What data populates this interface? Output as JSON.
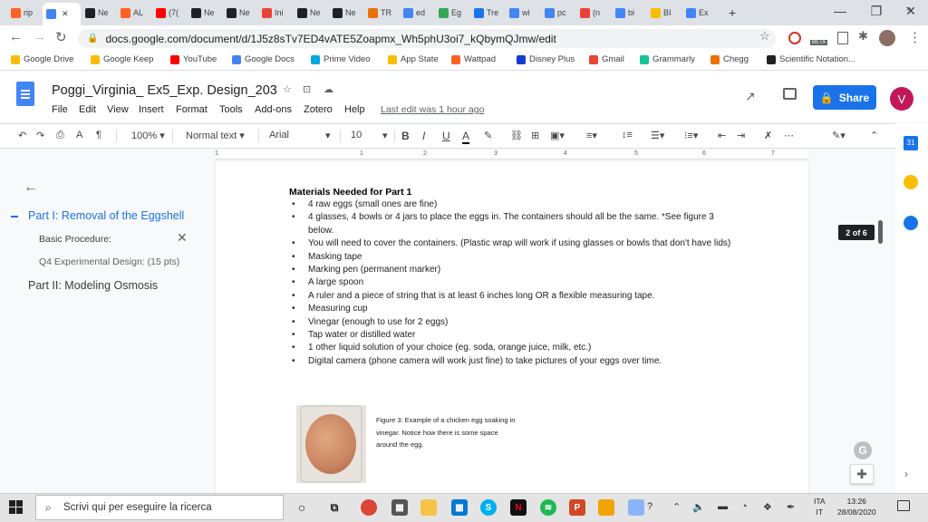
{
  "browser": {
    "tabs": [
      {
        "label": "rip",
        "icon": "wattpad-icon",
        "color": "#ff6122"
      },
      {
        "label": "",
        "icon": "docs-icon",
        "color": "#4285f4",
        "active": true
      },
      {
        "label": "Ne",
        "icon": "circle-icon",
        "color": "#202124"
      },
      {
        "label": "AL",
        "icon": "wattpad-icon",
        "color": "#ff6122"
      },
      {
        "label": "(7(",
        "icon": "youtube-icon",
        "color": "#ff0000"
      },
      {
        "label": "Ne",
        "icon": "car-icon",
        "color": "#202124"
      },
      {
        "label": "Ne",
        "icon": "car-icon",
        "color": "#202124"
      },
      {
        "label": "Ini",
        "icon": "gmail-icon",
        "color": "#ea4335"
      },
      {
        "label": "Ne",
        "icon": "circle-icon",
        "color": "#202124"
      },
      {
        "label": "Ne",
        "icon": "s-icon",
        "color": "#202124"
      },
      {
        "label": "TR",
        "icon": "badge-icon",
        "color": "#e8710a"
      },
      {
        "label": "ed",
        "icon": "slides-icon",
        "color": "#4285f4"
      },
      {
        "label": "Eg",
        "icon": "star-icon",
        "color": "#34a853"
      },
      {
        "label": "Tre",
        "icon": "st-icon",
        "color": "#1a73e8"
      },
      {
        "label": "wi",
        "icon": "google-icon",
        "color": "#4285f4"
      },
      {
        "label": "pc",
        "icon": "google-icon",
        "color": "#4285f4"
      },
      {
        "label": "(n",
        "icon": "gmail-icon",
        "color": "#ea4335"
      },
      {
        "label": "bi",
        "icon": "google-icon",
        "color": "#4285f4"
      },
      {
        "label": "BI",
        "icon": "arrow-icon",
        "color": "#fbbc04"
      },
      {
        "label": "Ex",
        "icon": "docs-icon",
        "color": "#4285f4"
      }
    ],
    "new_tab": "+",
    "url": "docs.google.com/document/d/1J5z8sTv7ED4vATE5Zoapmx_Wh5phU3oi7_kQbymQJmw/edit",
    "beta_badge": "BETA"
  },
  "bookmarks": [
    {
      "label": "Google Drive",
      "color": "#fbbc04"
    },
    {
      "label": "Google Keep",
      "color": "#fbbc04"
    },
    {
      "label": "YouTube",
      "color": "#ff0000"
    },
    {
      "label": "Google Docs",
      "color": "#4285f4"
    },
    {
      "label": "Prime Video",
      "color": "#00a8e1"
    },
    {
      "label": "App State",
      "color": "#fbbc04"
    },
    {
      "label": "Wattpad",
      "color": "#ff6122"
    },
    {
      "label": "Disney Plus",
      "color": "#113ccf"
    },
    {
      "label": "Gmail",
      "color": "#ea4335"
    },
    {
      "label": "Grammarly",
      "color": "#15c39a"
    },
    {
      "label": "Chegg",
      "color": "#eb7100"
    },
    {
      "label": "Scientific Notation...",
      "color": "#202124"
    }
  ],
  "docs": {
    "title": "Poggi_Virginia_ Ex5_Exp. Design_203",
    "menu": [
      "File",
      "Edit",
      "View",
      "Insert",
      "Format",
      "Tools",
      "Add-ons",
      "Zotero",
      "Help"
    ],
    "last_edit": "Last edit was 1 hour ago",
    "share_label": "Share",
    "avatar_letter": "V",
    "accent": "#1a73e8"
  },
  "toolbar": {
    "zoom": "100%",
    "style": "Normal text",
    "font": "Arial",
    "size": "10",
    "bold": "B",
    "italic": "I",
    "underline": "U",
    "text_color": "A",
    "more": "⋯"
  },
  "ruler": [
    "1",
    "1",
    "2",
    "3",
    "4",
    "5",
    "6",
    "7"
  ],
  "outline": {
    "items": [
      {
        "label": "Part I: Removal of the Eggshell",
        "level": 1,
        "active": true
      },
      {
        "label": "Basic Procedure:",
        "level": 2
      },
      {
        "label": "Q4 Experimental Design: (15 pts)",
        "level": 2
      },
      {
        "label": "Part II: Modeling Osmosis",
        "level": 1
      }
    ]
  },
  "document": {
    "heading": "Materials Needed for Part 1",
    "items": [
      "4 raw eggs (small ones are fine)",
      "4 glasses, 4 bowls or 4 jars to place the eggs in. The containers should all be the same. *See figure 3 below.",
      "You will need to cover the containers. (Plastic wrap will work if using glasses or bowls that don't have lids)",
      "Masking tape",
      "Marking pen (permanent marker)",
      "A large spoon",
      "A ruler and a piece of string that is at least 6 inches long OR a flexible measuring tape.",
      "Measuring cup",
      "Vinegar (enough to use for 2 eggs)",
      "Tap water or distilled water",
      "1 other liquid solution of your choice (eg. soda, orange juice, milk, etc.)",
      "Digital camera (phone camera will work just fine) to take pictures of your eggs over time."
    ],
    "figure_caption": "Figure 3: Example of a chicken egg soaking in vinegar. Notice how there is some space around the egg."
  },
  "page_indicator": "2 of 6",
  "side_panel": {
    "calendar_label": "31",
    "grammarly_letter": "G"
  },
  "taskbar": {
    "search_placeholder": "Scrivi qui per eseguire la ricerca",
    "lang": "ITA",
    "lang_sub": "IT",
    "time": "13:26",
    "date": "28/08/2020"
  }
}
